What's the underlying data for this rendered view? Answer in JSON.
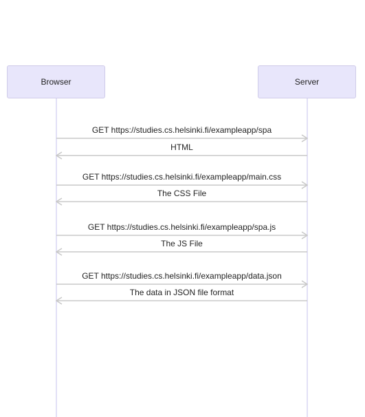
{
  "participants": [
    {
      "id": "browser",
      "label": "Browser"
    },
    {
      "id": "server",
      "label": "Server"
    }
  ],
  "messages": [
    {
      "from": "browser",
      "to": "server",
      "label": "GET https://studies.cs.helsinki.fi/exampleapp/spa"
    },
    {
      "from": "server",
      "to": "browser",
      "label": "HTML"
    },
    {
      "from": "browser",
      "to": "server",
      "label": "GET https://studies.cs.helsinki.fi/exampleapp/main.css"
    },
    {
      "from": "server",
      "to": "browser",
      "label": "The CSS File"
    },
    {
      "from": "browser",
      "to": "server",
      "label": "GET https://studies.cs.helsinki.fi/exampleapp/spa.js"
    },
    {
      "from": "server",
      "to": "browser",
      "label": "The JS File"
    },
    {
      "from": "browser",
      "to": "server",
      "label": "GET https://studies.cs.helsinki.fi/exampleapp/data.json"
    },
    {
      "from": "server",
      "to": "browser",
      "label": "The data in JSON file format"
    }
  ],
  "colors": {
    "participant_fill": "#e8e6fb",
    "participant_border": "#cfcbe9",
    "lifeline": "#d9d6f3",
    "arrow": "#c8c8c8",
    "text": "#222222"
  }
}
